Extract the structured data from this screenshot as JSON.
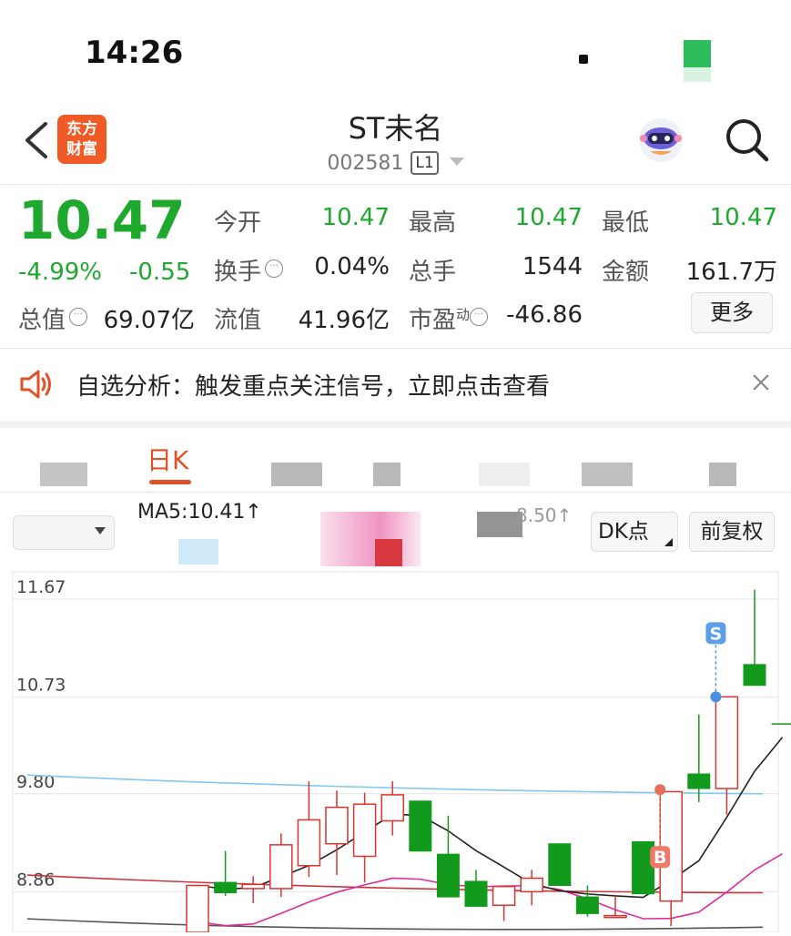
{
  "status_bar": {
    "time": "14:26"
  },
  "header": {
    "logo_line1": "东方",
    "logo_line2": "财富",
    "stock_name": "ST未名",
    "stock_code": "002581",
    "level": "L1"
  },
  "quote": {
    "price": "10.47",
    "change_pct": "-4.99%",
    "change": "-0.55",
    "fields": {
      "open_label": "今开",
      "open_value": "10.47",
      "high_label": "最高",
      "high_value": "10.47",
      "low_label": "最低",
      "low_value": "10.47",
      "turnover_label": "换手",
      "turnover_value": "0.04%",
      "volume_label": "总手",
      "volume_value": "1544",
      "amount_label": "金额",
      "amount_value": "161.7万",
      "mktcap_label": "总值",
      "mktcap_value": "69.07亿",
      "float_label": "流值",
      "float_value": "41.96亿",
      "pe_label": "市盈",
      "pe_sup": "动",
      "pe_value": "-46.86"
    },
    "more_button": "更多"
  },
  "notice": {
    "text": "自选分析：触发重点关注信号，立即点击查看"
  },
  "tabs": {
    "active_label": "日K"
  },
  "indicators": {
    "ma5": "MA5:10.41↑",
    "ma_other_partial": "8.50↑",
    "dk_button": "DK点",
    "adjust_button": "前复权"
  },
  "chart_data": {
    "type": "candlestick",
    "y_ticks": [
      "11.67",
      "10.73",
      "9.80",
      "8.86"
    ],
    "ylim": [
      8.47,
      11.93
    ],
    "colors": {
      "up": "#d9342f",
      "down": "#129a1c",
      "ma5": "#222222",
      "ma10": "#e02c9a",
      "ma20": "#c9353a",
      "ma60": "#83c8f0",
      "ma120": "#555555"
    },
    "candles": [
      {
        "o": 8.47,
        "h": 8.92,
        "l": 8.47,
        "c": 8.92
      },
      {
        "o": 8.95,
        "h": 9.25,
        "l": 8.82,
        "c": 8.85
      },
      {
        "o": 8.89,
        "h": 9.01,
        "l": 8.75,
        "c": 8.93
      },
      {
        "o": 8.89,
        "h": 9.42,
        "l": 8.81,
        "c": 9.31
      },
      {
        "o": 9.11,
        "h": 9.92,
        "l": 9.0,
        "c": 9.55
      },
      {
        "o": 9.32,
        "h": 9.83,
        "l": 9.02,
        "c": 9.67
      },
      {
        "o": 9.2,
        "h": 9.81,
        "l": 8.95,
        "c": 9.7
      },
      {
        "o": 9.54,
        "h": 9.92,
        "l": 9.4,
        "c": 9.79
      },
      {
        "o": 9.73,
        "h": 9.73,
        "l": 9.25,
        "c": 9.25
      },
      {
        "o": 9.22,
        "h": 9.59,
        "l": 8.81,
        "c": 8.81
      },
      {
        "o": 8.96,
        "h": 9.07,
        "l": 8.72,
        "c": 8.72
      },
      {
        "o": 8.73,
        "h": 8.91,
        "l": 8.58,
        "c": 8.91
      },
      {
        "o": 8.86,
        "h": 9.07,
        "l": 8.73,
        "c": 8.99
      },
      {
        "o": 9.32,
        "h": 9.32,
        "l": 8.92,
        "c": 8.92
      },
      {
        "o": 8.81,
        "h": 8.92,
        "l": 8.62,
        "c": 8.65
      },
      {
        "o": 8.63,
        "h": 8.83,
        "l": 8.63,
        "c": 8.63
      },
      {
        "o": 9.34,
        "h": 9.34,
        "l": 8.84,
        "c": 8.84
      },
      {
        "o": 8.77,
        "h": 9.82,
        "l": 8.53,
        "c": 9.82
      },
      {
        "o": 9.99,
        "h": 10.56,
        "l": 9.72,
        "c": 9.85
      },
      {
        "o": 9.85,
        "h": 10.73,
        "l": 9.6,
        "c": 10.73
      },
      {
        "o": 11.04,
        "h": 11.76,
        "l": 10.84,
        "c": 10.84
      },
      {
        "o": 10.47,
        "h": 10.47,
        "l": 10.47,
        "c": 10.47
      }
    ],
    "signals": [
      {
        "label": "S",
        "index": 19
      },
      {
        "label": "B",
        "index": 17
      }
    ]
  }
}
